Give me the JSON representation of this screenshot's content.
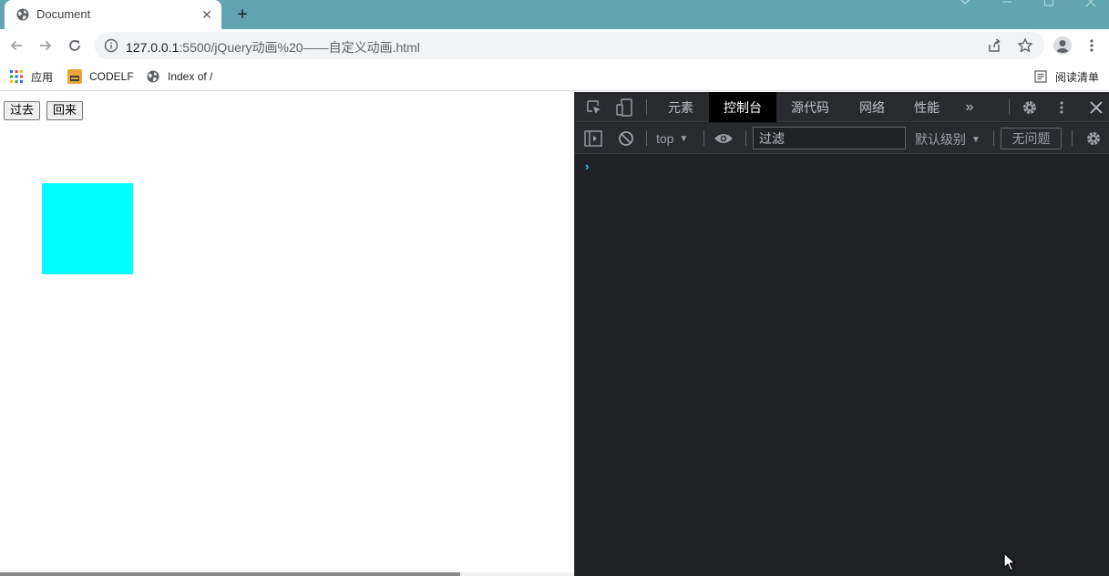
{
  "browser": {
    "tab": {
      "title": "Document",
      "close_glyph": "✕",
      "favicon": "globe-icon"
    },
    "new_tab_glyph": "+",
    "address": {
      "host": "127.0.0.1",
      "path": ":5500/jQuery动画%20——自定义动画.html"
    },
    "bookmarks": [
      {
        "label": "应用",
        "icon": "apps-grid-icon"
      },
      {
        "label": "CODELF",
        "icon": "codelf-favicon"
      },
      {
        "label": "Index of /",
        "icon": "globe-icon"
      }
    ],
    "reading_list": "阅读清单"
  },
  "page": {
    "buttons": [
      "过去",
      "回来"
    ],
    "box_color": "#00ffff"
  },
  "devtools": {
    "tabs": [
      "元素",
      "控制台",
      "源代码",
      "网络",
      "性能"
    ],
    "active_tab": "控制台",
    "more_glyph": "»",
    "context": "top",
    "context_arrow": "▼",
    "filter_placeholder": "过滤",
    "level": "默认级别",
    "issues": "无问题",
    "prompt": "›"
  },
  "colors": {
    "tabstrip": "#62a5b0",
    "devtools_bg": "#202124",
    "active_tab_bg": "#000000",
    "prompt": "#4fc1ff"
  }
}
